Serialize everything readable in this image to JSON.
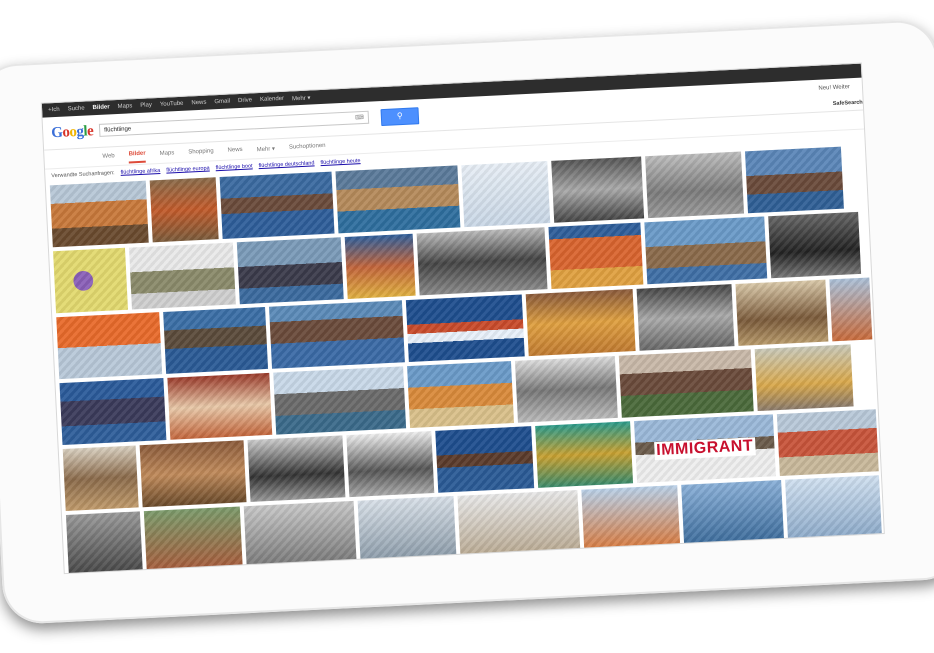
{
  "topbar": {
    "items": [
      "+Ich",
      "Suche",
      "Bilder",
      "Maps",
      "Play",
      "YouTube",
      "News",
      "Gmail",
      "Drive",
      "Kalender",
      "Mehr ▾"
    ],
    "active_index": 2
  },
  "header": {
    "logo": "Google",
    "query": "flüchtlinge",
    "keyboard_icon": "keyboard-icon",
    "search_button_icon": "magnifier-icon",
    "signin": "Neu! Weiter",
    "safesearch": "SafeSearch"
  },
  "tabs": {
    "items": [
      "Web",
      "Bilder",
      "Maps",
      "Shopping",
      "News",
      "Mehr ▾",
      "Suchoptionen"
    ],
    "active_index": 1
  },
  "related": {
    "label": "Verwandte Suchanfragen:",
    "links": [
      "flüchtlinge afrika",
      "flüchtlinge europa",
      "flüchtlinge boot",
      "flüchtlinge deutschland",
      "flüchtlinge heute"
    ]
  },
  "images": {
    "immigrant_text": "IMMIGRANT",
    "colors": {
      "sea": "#2e5e9a",
      "orange": "#d9782e",
      "bw": "#8a8a8a",
      "sand": "#c9a77a"
    }
  }
}
